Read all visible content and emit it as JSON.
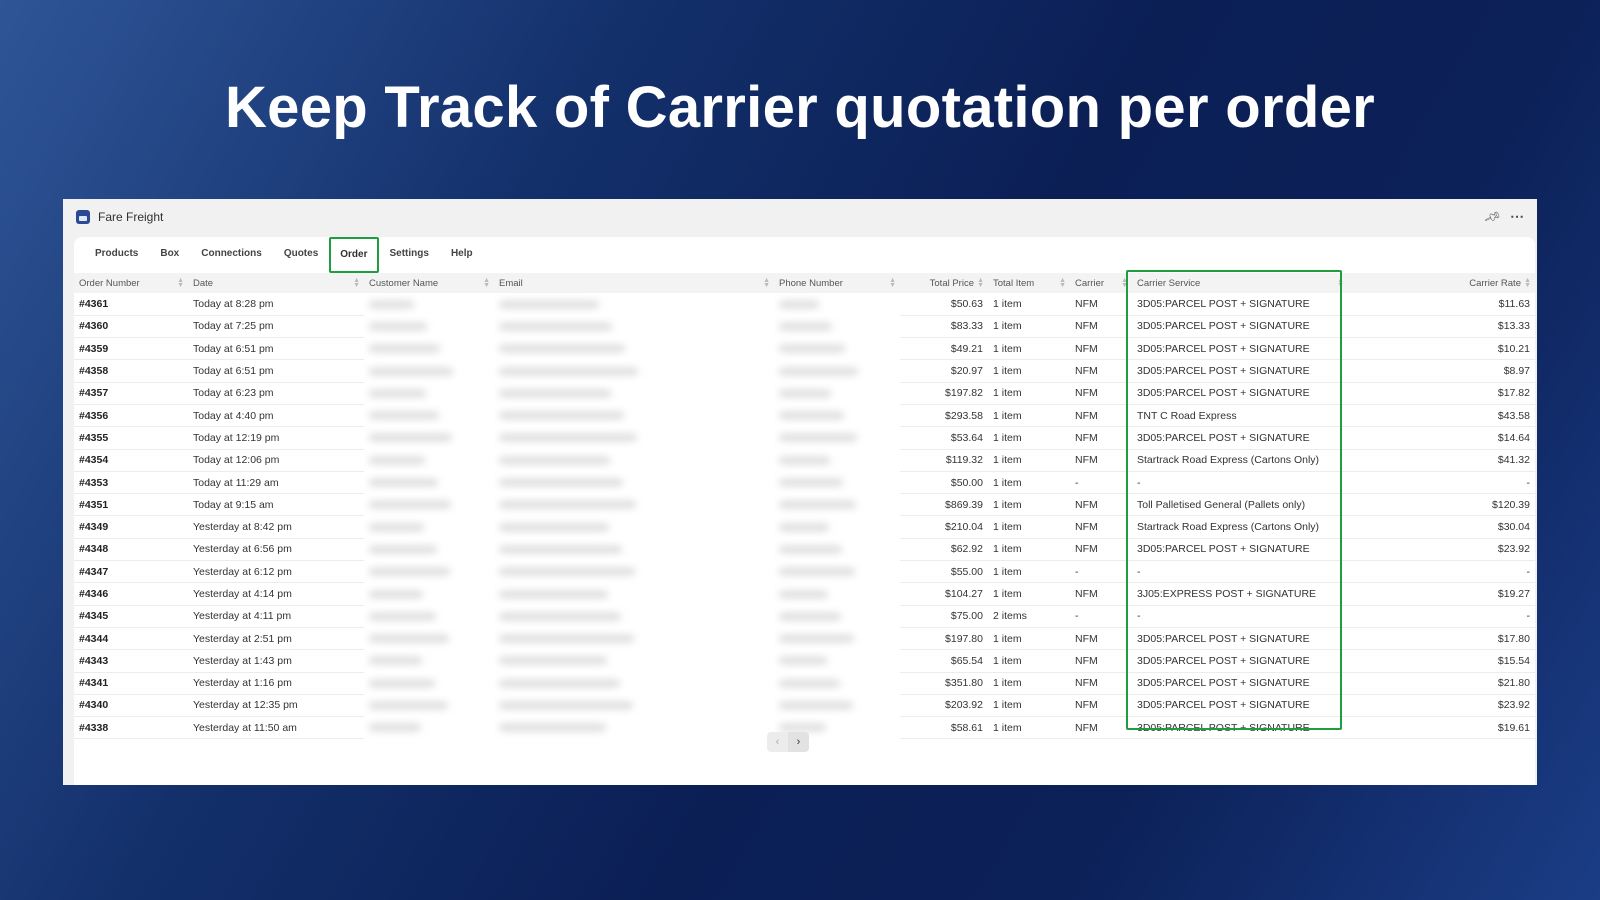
{
  "headline": "Keep Track of Carrier quotation per order",
  "window": {
    "app_title": "Fare Freight",
    "pin_icon": "pin-icon",
    "more_icon": "more-icon"
  },
  "tabs": [
    {
      "label": "Products",
      "active": false
    },
    {
      "label": "Box",
      "active": false
    },
    {
      "label": "Connections",
      "active": false
    },
    {
      "label": "Quotes",
      "active": false
    },
    {
      "label": "Order",
      "active": true
    },
    {
      "label": "Settings",
      "active": false
    },
    {
      "label": "Help",
      "active": false
    }
  ],
  "columns": [
    "Order Number",
    "Date",
    "Customer Name",
    "Email",
    "Phone Number",
    "Total Price",
    "Total Item",
    "Carrier",
    "Carrier Service",
    "Carrier Rate"
  ],
  "rows": [
    {
      "order": "#4361",
      "date": "Today at 8:28 pm",
      "price": "$50.63",
      "items": "1 item",
      "carrier": "NFM",
      "service": "3D05:PARCEL POST + SIGNATURE",
      "rate": "$11.63"
    },
    {
      "order": "#4360",
      "date": "Today at 7:25 pm",
      "price": "$83.33",
      "items": "1 item",
      "carrier": "NFM",
      "service": "3D05:PARCEL POST + SIGNATURE",
      "rate": "$13.33"
    },
    {
      "order": "#4359",
      "date": "Today at 6:51 pm",
      "price": "$49.21",
      "items": "1 item",
      "carrier": "NFM",
      "service": "3D05:PARCEL POST + SIGNATURE",
      "rate": "$10.21"
    },
    {
      "order": "#4358",
      "date": "Today at 6:51 pm",
      "price": "$20.97",
      "items": "1 item",
      "carrier": "NFM",
      "service": "3D05:PARCEL POST + SIGNATURE",
      "rate": "$8.97"
    },
    {
      "order": "#4357",
      "date": "Today at 6:23 pm",
      "price": "$197.82",
      "items": "1 item",
      "carrier": "NFM",
      "service": "3D05:PARCEL POST + SIGNATURE",
      "rate": "$17.82"
    },
    {
      "order": "#4356",
      "date": "Today at 4:40 pm",
      "price": "$293.58",
      "items": "1 item",
      "carrier": "NFM",
      "service": "TNT C Road Express",
      "rate": "$43.58"
    },
    {
      "order": "#4355",
      "date": "Today at 12:19 pm",
      "price": "$53.64",
      "items": "1 item",
      "carrier": "NFM",
      "service": "3D05:PARCEL POST + SIGNATURE",
      "rate": "$14.64"
    },
    {
      "order": "#4354",
      "date": "Today at 12:06 pm",
      "price": "$119.32",
      "items": "1 item",
      "carrier": "NFM",
      "service": "Startrack Road Express (Cartons Only)",
      "rate": "$41.32"
    },
    {
      "order": "#4353",
      "date": "Today at 11:29 am",
      "price": "$50.00",
      "items": "1 item",
      "carrier": "-",
      "service": "-",
      "rate": "-"
    },
    {
      "order": "#4351",
      "date": "Today at 9:15 am",
      "price": "$869.39",
      "items": "1 item",
      "carrier": "NFM",
      "service": "Toll Palletised General (Pallets only)",
      "rate": "$120.39"
    },
    {
      "order": "#4349",
      "date": "Yesterday at 8:42 pm",
      "price": "$210.04",
      "items": "1 item",
      "carrier": "NFM",
      "service": "Startrack Road Express (Cartons Only)",
      "rate": "$30.04"
    },
    {
      "order": "#4348",
      "date": "Yesterday at 6:56 pm",
      "price": "$62.92",
      "items": "1 item",
      "carrier": "NFM",
      "service": "3D05:PARCEL POST + SIGNATURE",
      "rate": "$23.92"
    },
    {
      "order": "#4347",
      "date": "Yesterday at 6:12 pm",
      "price": "$55.00",
      "items": "1 item",
      "carrier": "-",
      "service": "-",
      "rate": "-"
    },
    {
      "order": "#4346",
      "date": "Yesterday at 4:14 pm",
      "price": "$104.27",
      "items": "1 item",
      "carrier": "NFM",
      "service": "3J05:EXPRESS POST + SIGNATURE",
      "rate": "$19.27"
    },
    {
      "order": "#4345",
      "date": "Yesterday at 4:11 pm",
      "price": "$75.00",
      "items": "2 items",
      "carrier": "-",
      "service": "-",
      "rate": "-"
    },
    {
      "order": "#4344",
      "date": "Yesterday at 2:51 pm",
      "price": "$197.80",
      "items": "1 item",
      "carrier": "NFM",
      "service": "3D05:PARCEL POST + SIGNATURE",
      "rate": "$17.80"
    },
    {
      "order": "#4343",
      "date": "Yesterday at 1:43 pm",
      "price": "$65.54",
      "items": "1 item",
      "carrier": "NFM",
      "service": "3D05:PARCEL POST + SIGNATURE",
      "rate": "$15.54"
    },
    {
      "order": "#4341",
      "date": "Yesterday at 1:16 pm",
      "price": "$351.80",
      "items": "1 item",
      "carrier": "NFM",
      "service": "3D05:PARCEL POST + SIGNATURE",
      "rate": "$21.80"
    },
    {
      "order": "#4340",
      "date": "Yesterday at 12:35 pm",
      "price": "$203.92",
      "items": "1 item",
      "carrier": "NFM",
      "service": "3D05:PARCEL POST + SIGNATURE",
      "rate": "$23.92"
    },
    {
      "order": "#4338",
      "date": "Yesterday at 11:50 am",
      "price": "$58.61",
      "items": "1 item",
      "carrier": "NFM",
      "service": "3D05:PARCEL POST + SIGNATURE",
      "rate": "$19.61"
    }
  ],
  "pagination": {
    "prev_icon": "chevron-left-icon",
    "next_icon": "chevron-right-icon"
  },
  "colors": {
    "highlight": "#1e9e3e",
    "background_dark": "#0b1f55",
    "background_light": "#2f5597"
  }
}
